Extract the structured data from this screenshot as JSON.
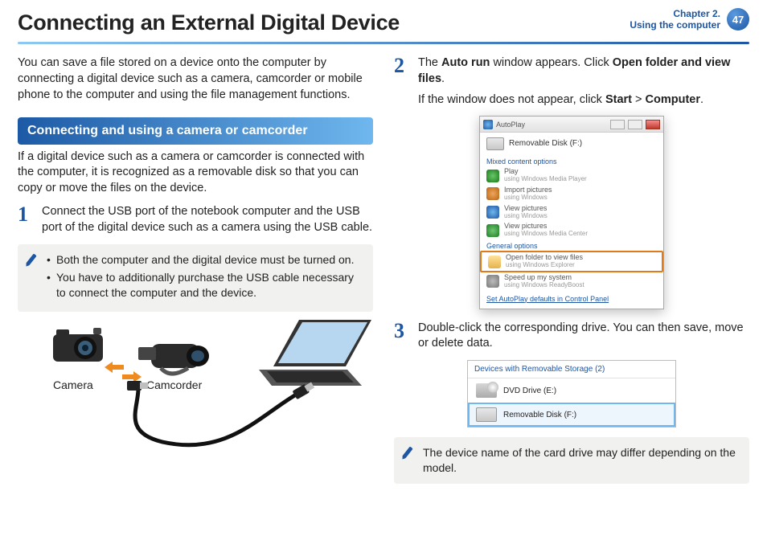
{
  "header": {
    "title": "Connecting an External Digital Device",
    "chapter_line1": "Chapter 2.",
    "chapter_line2": "Using the computer",
    "page_number": "47"
  },
  "left": {
    "intro": "You can save a file stored on a device onto the computer by connecting a digital device such as a camera, camcorder or mobile phone to the computer and using the file management functions.",
    "section_bar": "Connecting and using a camera or camcorder",
    "section_intro": "If a digital device such as a camera or camcorder is connected with the computer, it is recognized as a removable disk so that you can copy or move the files on the device.",
    "step1_num": "1",
    "step1": "Connect the USB port of the notebook computer and the USB port of the digital device such as a camera using the USB cable.",
    "note": {
      "b1": "Both the computer and the digital device must be turned on.",
      "b2": "You have to additionally purchase the USB cable necessary to connect the computer and the device."
    },
    "labels": {
      "camera": "Camera",
      "camcorder": "Camcorder"
    }
  },
  "right": {
    "step2_num": "2",
    "step2_pre": "The ",
    "step2_b1": "Auto run",
    "step2_mid": " window appears. Click ",
    "step2_b2": "Open folder and view files",
    "step2_post": ".",
    "step2_line2_pre": "If the window does not appear, click ",
    "step2_line2_b1": "Start",
    "step2_line2_mid": " > ",
    "step2_line2_b2": "Computer",
    "step2_line2_post": ".",
    "autoplay": {
      "title": "AutoPlay",
      "drive": "Removable Disk (F:)",
      "group_mixed": "Mixed content options",
      "play": "Play",
      "play_sub": "using Windows Media Player",
      "import": "Import pictures",
      "import_sub": "using Windows",
      "view": "View pictures",
      "view_sub": "using Windows",
      "view2": "View pictures",
      "view2_sub": "using Windows Media Center",
      "group_general": "General options",
      "open": "Open folder to view files",
      "open_sub": "using Windows Explorer",
      "speed": "Speed up my system",
      "speed_sub": "using Windows ReadyBoost",
      "footer": "Set AutoPlay defaults in Control Panel"
    },
    "step3_num": "3",
    "step3": "Double-click the corresponding drive. You can then save, move or delete data.",
    "storage": {
      "header": "Devices with Removable Storage (2)",
      "dvd": "DVD Drive (E:)",
      "removable": "Removable Disk (F:)"
    },
    "note": "The device name of the card drive may differ depending on the model."
  }
}
